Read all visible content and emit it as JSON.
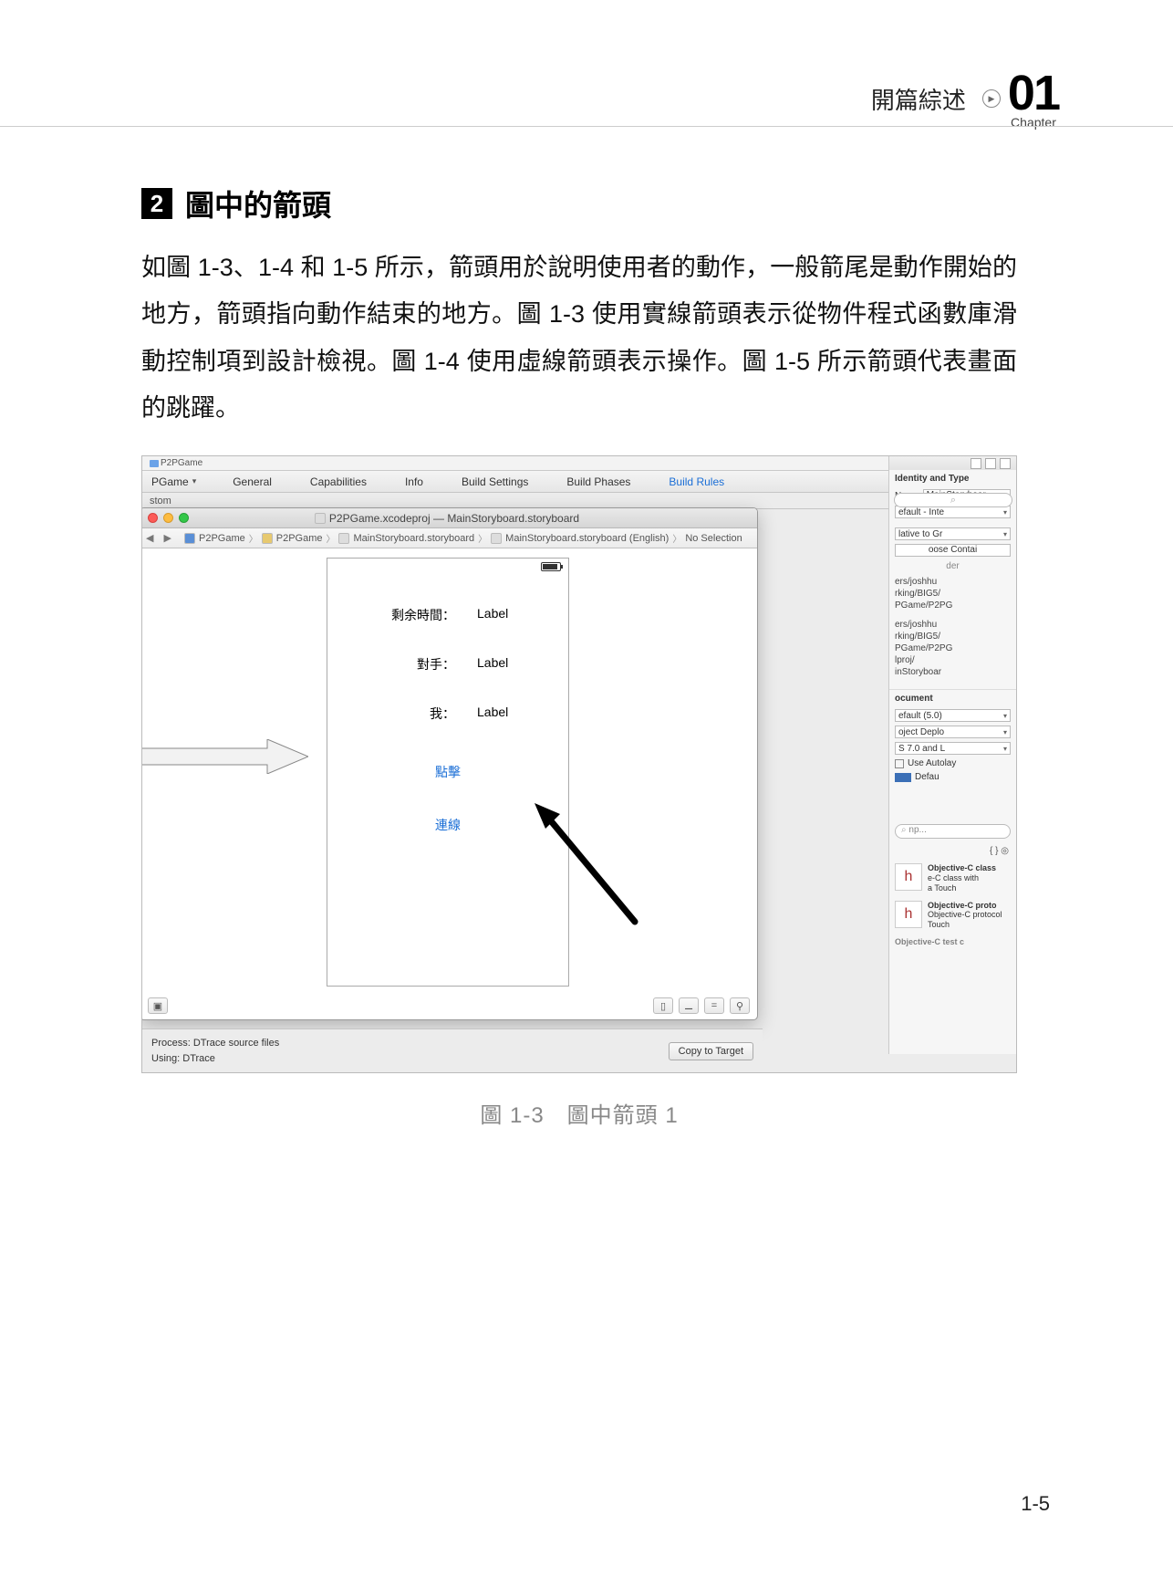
{
  "header": {
    "title": "開篇綜述",
    "chapter_number": "01",
    "chapter_label": "Chapter"
  },
  "section": {
    "badge": "2",
    "title": "圖中的箭頭"
  },
  "body_text": "如圖 1-3、1-4 和 1-5 所示，箭頭用於說明使用者的動作，一般箭尾是動作開始的地方，箭頭指向動作結束的地方。圖 1-3 使用實線箭頭表示從物件程式函數庫滑動控制項到設計檢視。圖 1-4 使用虛線箭頭表示操作。圖 1-5 所示箭頭代表畫面的跳躍。",
  "figure": {
    "proj_nav_file": "P2PGame",
    "tabs": {
      "project": "PGame",
      "general": "General",
      "capabilities": "Capabilities",
      "info": "Info",
      "build_settings": "Build Settings",
      "build_phases": "Build Phases",
      "build_rules": "Build Rules"
    },
    "below_line": "stom",
    "window_title": "P2PGame.xcodeproj — MainStoryboard.storyboard",
    "jump_bar": {
      "seg1": "P2PGame",
      "seg2": "P2PGame",
      "seg3": "MainStoryboard.storyboard",
      "seg4": "MainStoryboard.storyboard (English)",
      "seg5": "No Selection"
    },
    "device": {
      "row1_key": "剩余時間：",
      "row1_val": "Label",
      "row2_key": "對手：",
      "row2_val": "Label",
      "row3_key": "我：",
      "row3_val": "Label",
      "link1": "點擊",
      "link2": "連線"
    },
    "inspector": {
      "section_title": "Identity and Type",
      "name_label": "Name",
      "name_value": "MainStoryboar",
      "type_value": "efault - Inte",
      "loc_value": "lative to Gr",
      "choose": "oose Contai",
      "choose2": "der",
      "path1a": "ers/joshhu",
      "path1b": "rking/BIG5/",
      "path1c": "PGame/P2PG",
      "path2a": "ers/joshhu",
      "path2b": "rking/BIG5/",
      "path2c": "PGame/P2PG",
      "path2d": "lproj/",
      "path2e": "inStoryboar",
      "doc_label": "ocument",
      "opens_value": "efault (5.0)",
      "builds_value": "oject Deplo",
      "view_value": "S 7.0 and L",
      "autolayout_label": "Use Autolay",
      "tint_label": "Defau",
      "search_placeholder": "np...",
      "lib1_title": "Objective-C class",
      "lib1_sub": "e-C class with",
      "lib1_sub2": "a Touch",
      "lib2_title": "Objective-C proto",
      "lib2_sub": "Objective-C protocol",
      "lib2_sub2": "Touch",
      "lib3_title": "Objective-C test c"
    },
    "bottom": {
      "process_label": "Process:",
      "process_value": "DTrace source files",
      "using_label": "Using:",
      "using_value": "DTrace",
      "copy_button": "Copy to Target"
    },
    "search_icon": "⌕"
  },
  "caption": "圖 1-3　圖中箭頭 1",
  "page_number": "1-5"
}
